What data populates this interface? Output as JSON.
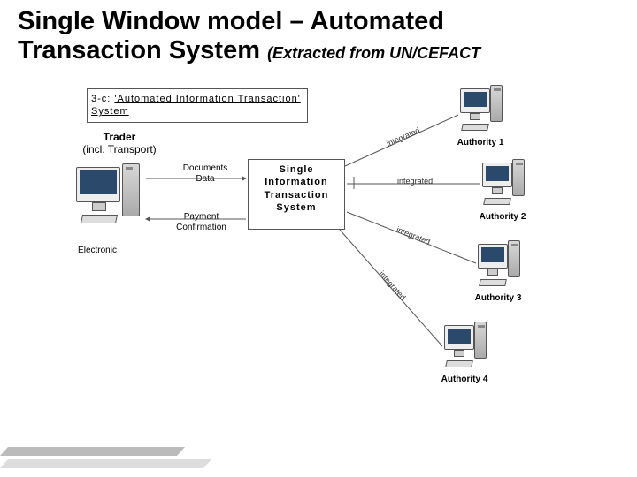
{
  "title_line1": "Single Window model – Automated",
  "title_line2_main": "Transaction System",
  "title_line2_sub": "(Extracted from UN/CEFACT",
  "header_prefix": "3-c: ",
  "header_underlined": "'Automated Information Transaction' System",
  "trader_label": "Trader",
  "trader_sublabel": "(incl. Transport)",
  "electronic_label": "Electronic",
  "sits_line1": "Single",
  "sits_line2": "Information",
  "sits_line3": "Transaction",
  "sits_line4": "System",
  "flow_docs": "Documents\nData",
  "flow_pay": "Payment\nConfirmation",
  "auth1": "Authority 1",
  "auth2": "Authority 2",
  "auth3": "Authority 3",
  "auth4": "Authority 4",
  "edge_integrated": "integrated"
}
